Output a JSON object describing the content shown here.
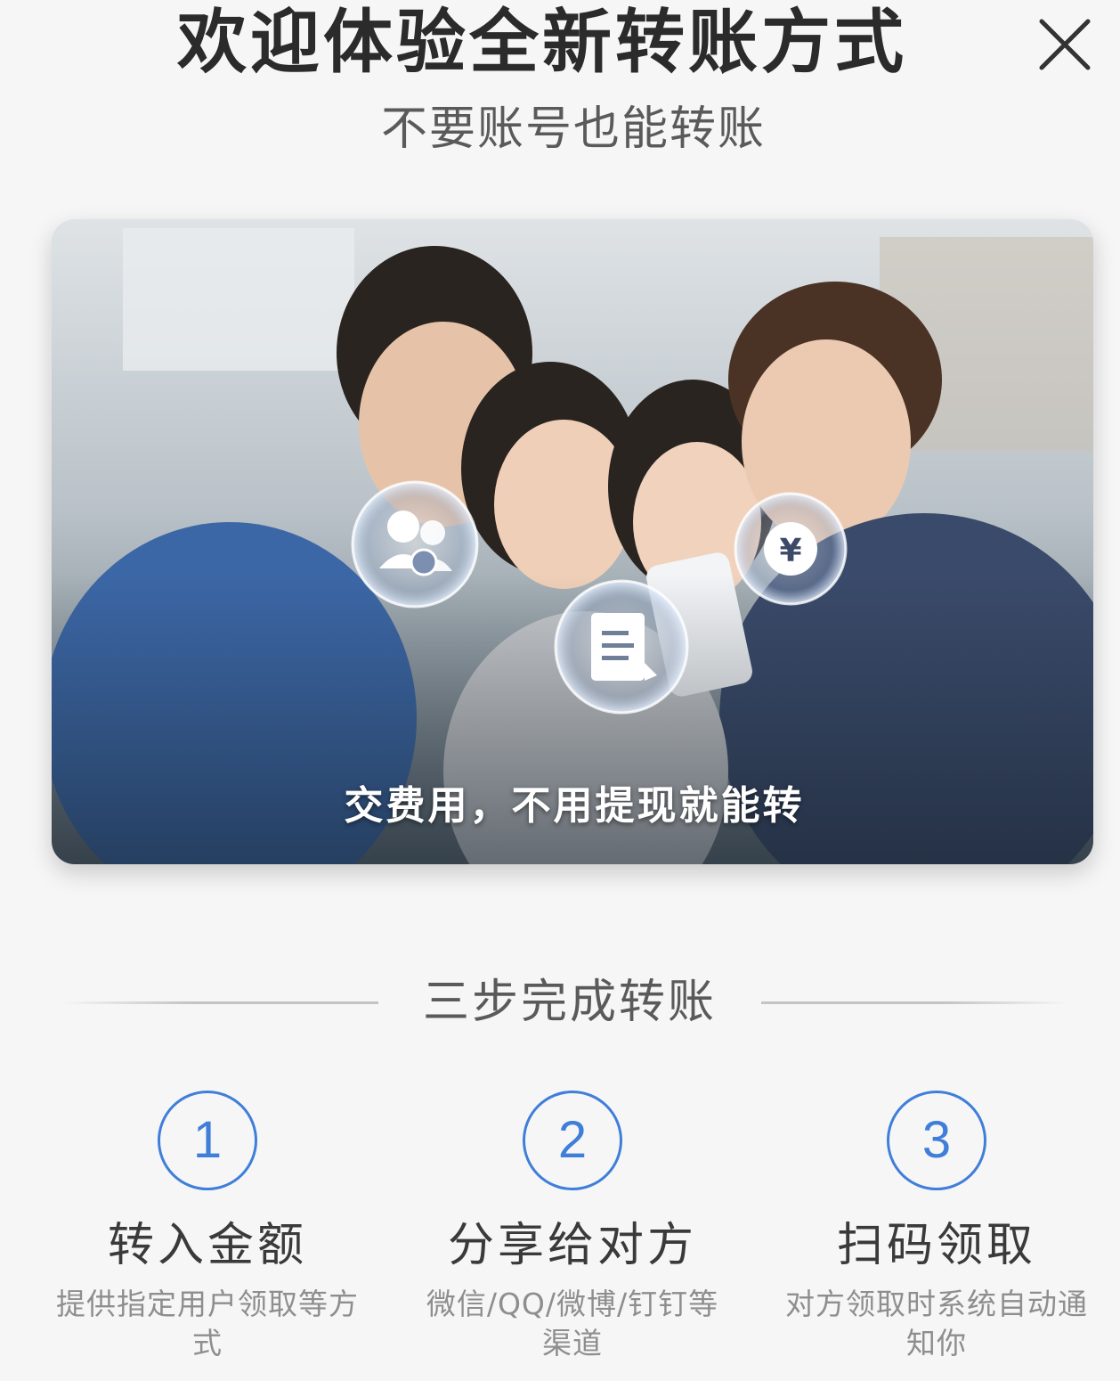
{
  "header": {
    "title": "欢迎体验全新转账方式",
    "subtitle": "不要账号也能转账"
  },
  "banner": {
    "caption": "交费用，不用提现就能转",
    "bubbles": [
      "users-money-icon",
      "document-icon",
      "yuan-icon"
    ],
    "yuan_symbol": "¥"
  },
  "steps_section": {
    "heading": "三步完成转账",
    "steps": [
      {
        "number": "1",
        "title": "转入金额",
        "desc": "提供指定用户领取等方式"
      },
      {
        "number": "2",
        "title": "分享给对方",
        "desc": "微信/QQ/微博/钉钉等渠道"
      },
      {
        "number": "3",
        "title": "扫码领取",
        "desc": "对方领取时系统自动通知你"
      }
    ]
  },
  "colors": {
    "accent": "#3f7ed9",
    "title_text": "#2b2b2b",
    "muted_text": "#8e8e8e"
  }
}
